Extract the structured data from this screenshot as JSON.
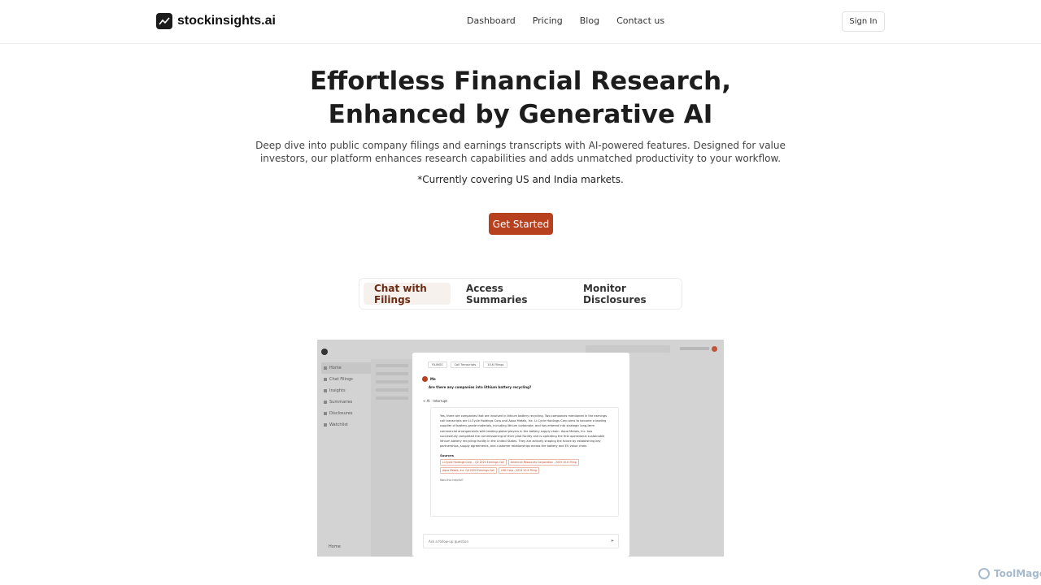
{
  "header": {
    "brand": "stockinsights.ai",
    "nav": [
      "Dashboard",
      "Pricing",
      "Blog",
      "Contact us"
    ],
    "signin": "Sign In"
  },
  "hero": {
    "title_line1": "Effortless Financial Research,",
    "title_line2": "Enhanced by Generative AI",
    "subtitle": "Deep dive into public company filings and earnings transcripts with AI-powered features. Designed for value investors, our platform enhances research capabilities and adds unmatched productivity to your workflow.",
    "note": "*Currently covering US and India markets.",
    "cta": "Get Started"
  },
  "tabs": [
    "Chat with Filings",
    "Access Summaries",
    "Monitor Disclosures"
  ],
  "preview": {
    "sidebar": [
      "Home",
      "Chat Filings",
      "Insights",
      "Summaries",
      "Disclosures",
      "Watchlist"
    ],
    "sidebar_bottom": "Home",
    "card": {
      "doc_tabs": [
        "FILINGS",
        "Call Transcripts",
        "10-K Filings"
      ],
      "me_label": "Me",
      "question": "Are there any companies into lithium battery recycling?",
      "ai_label": "AI",
      "ai_status": "Interrupt",
      "answer": "Yes, there are companies that are involved in lithium battery recycling. Two companies mentioned in the earnings call transcripts are Li-Cycle Holdings Corp and Aqua Metals, Inc. Li-Cycle Holdings Corp aims to become a leading supplier of battery-grade materials, including lithium carbonate, and has entered into strategic long-term commercial arrangements with leading global players in the battery supply chain. Aqua Metals, Inc. has successfully completed the commissioning of their pilot facility and is operating the first operational sustainable lithium battery recycling facility in the United States. They are actively shaping the future by establishing key partnerships, supply agreements, and customer relationships across the battery and EV value chain.",
      "sources_label": "Sources",
      "sources": [
        "Li-Cycle Holdings Corp. - Q2 2023 Earnings Call",
        "American Resources Corporation - 2023 10-K Filing",
        "Aqua Metals, Inc. Q4 2022 Earnings Call",
        "LHD Corp - 2023 10-K Filing"
      ],
      "helpful": "Was this helpful?",
      "input_placeholder": "Ask a follow-up question"
    }
  },
  "watermark": "ToolMage",
  "colors": {
    "accent": "#b7401e",
    "tab_active_bg": "#f7f1ee",
    "preview_bg": "#d3d3d3"
  }
}
